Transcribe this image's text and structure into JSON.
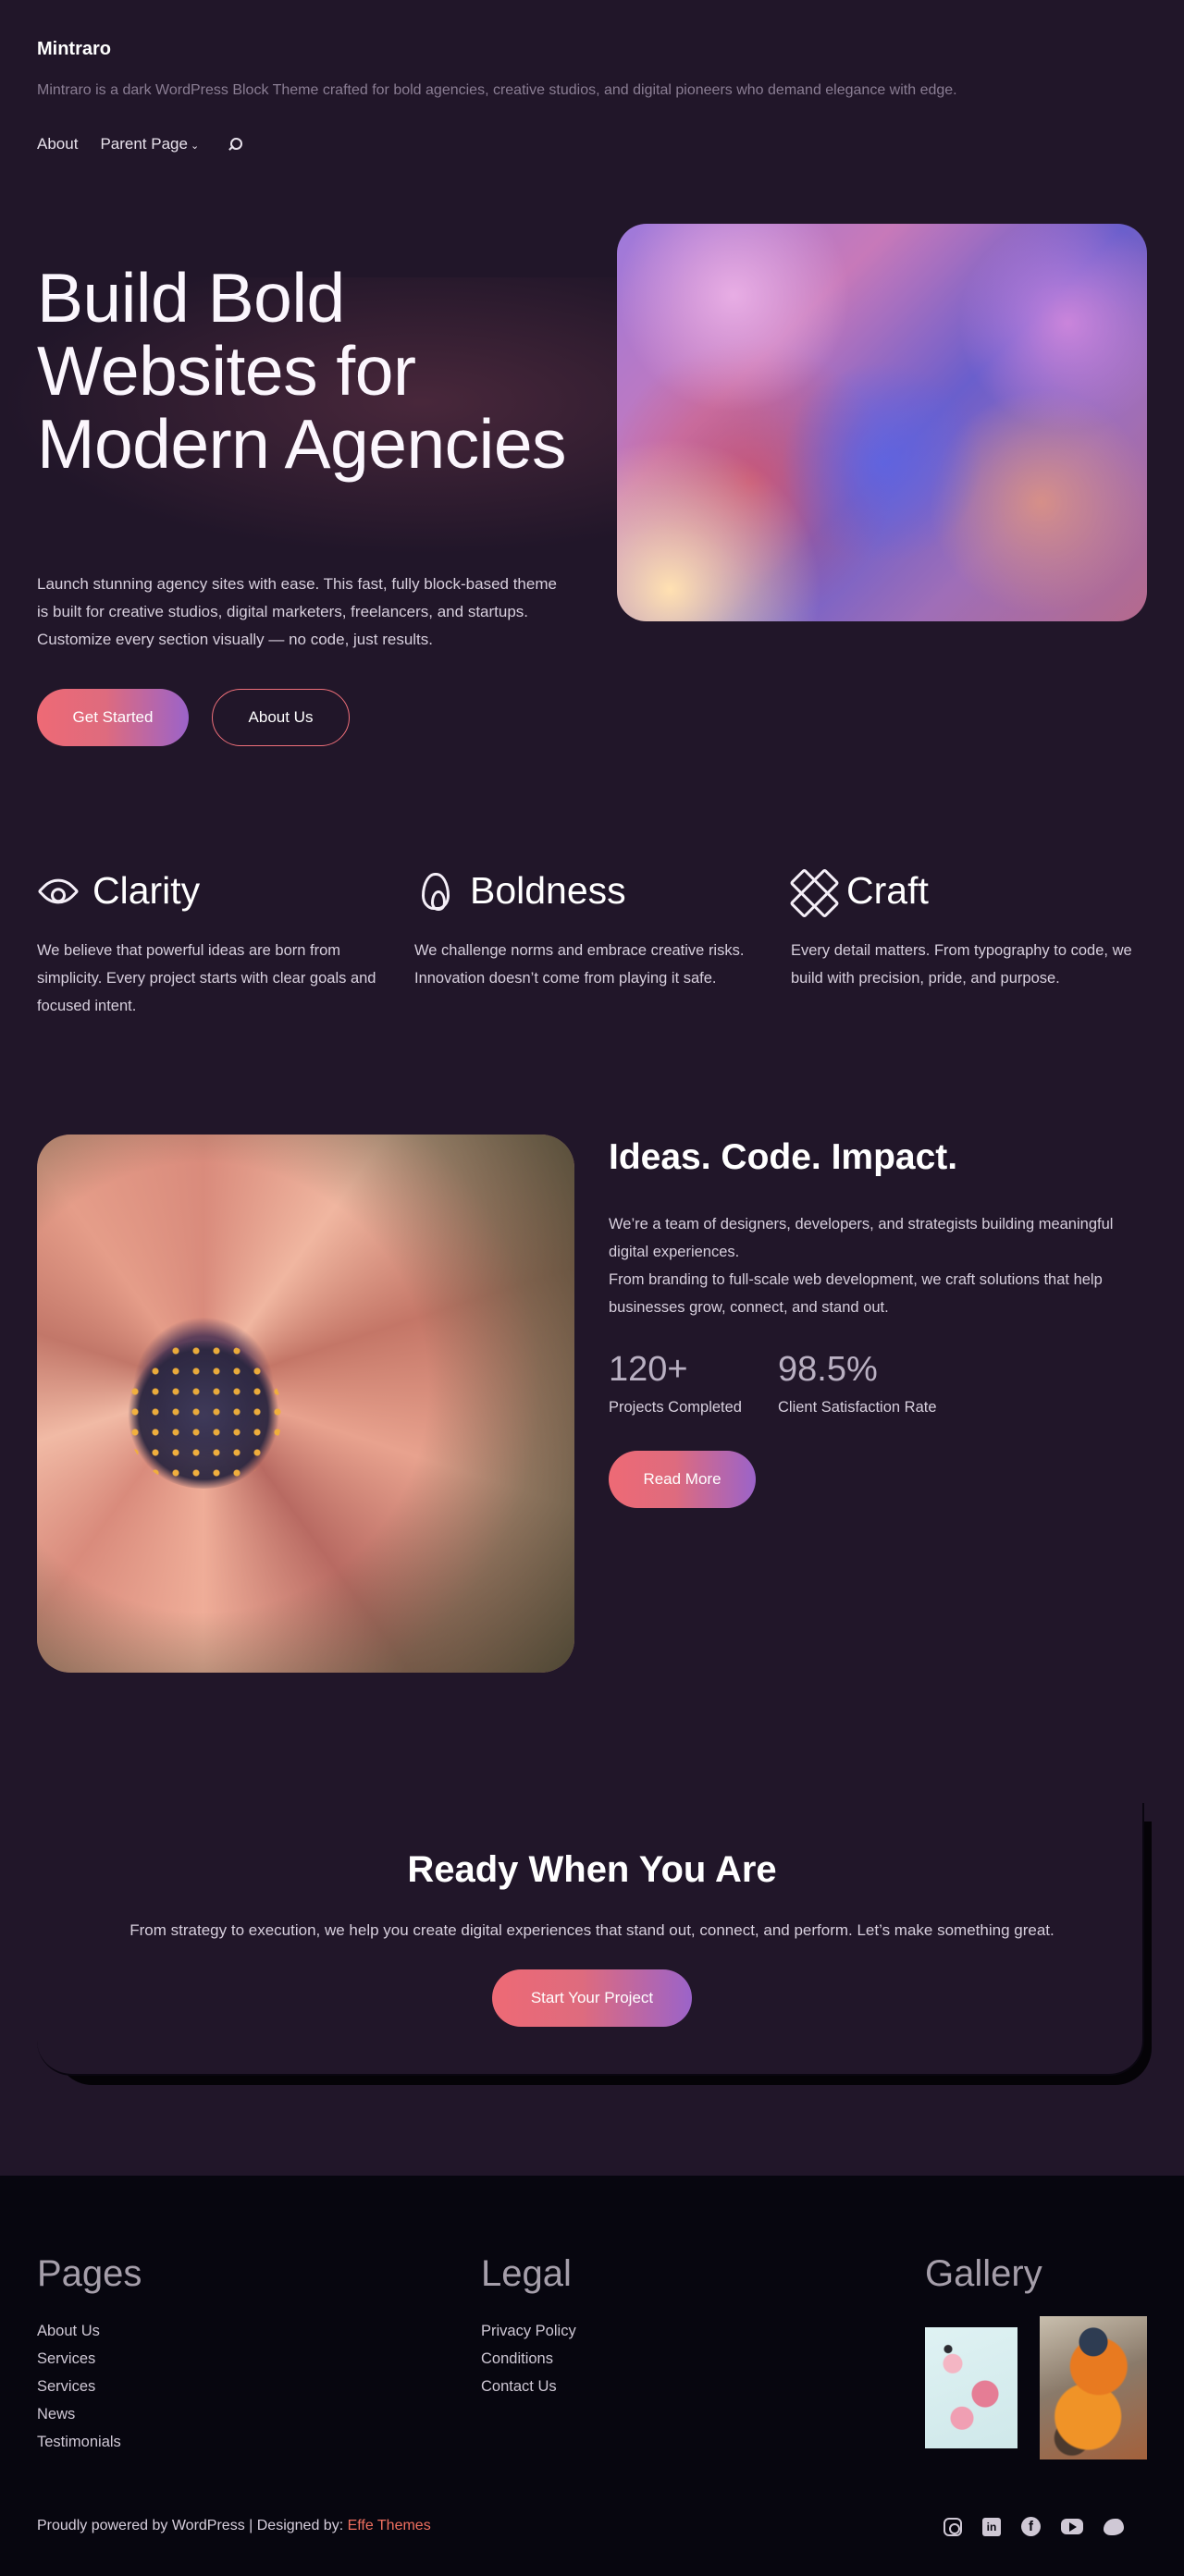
{
  "header": {
    "site_title": "Mintraro",
    "tagline": "Mintraro is a dark WordPress Block Theme crafted for bold agencies, creative studios, and digital pioneers who demand elegance with edge.",
    "nav": [
      {
        "label": "About"
      },
      {
        "label": "Parent Page",
        "has_submenu": true
      }
    ],
    "search_icon": "search-icon"
  },
  "hero": {
    "title": "Build Bold Websites for Modern Agencies",
    "text": "Launch stunning agency sites with ease. This fast, fully block-based theme is built for creative studios, digital marketers, freelancers, and startups. Customize every section visually — no code, just results.",
    "primary_button": "Get Started",
    "secondary_button": "About Us"
  },
  "values": [
    {
      "icon": "eye-icon",
      "title": "Clarity",
      "text": "We believe that powerful ideas are born from simplicity. Every project starts with clear goals and focused intent."
    },
    {
      "icon": "flame-icon",
      "title": "Boldness",
      "text": "We challenge norms and embrace creative risks. Innovation doesn’t come from playing it safe."
    },
    {
      "icon": "pencil-ruler-icon",
      "title": "Craft",
      "text": "Every detail matters. From typography to code, we build with precision, pride, and purpose."
    }
  ],
  "about": {
    "title": "Ideas. Code. Impact.",
    "text1": "We’re a team of designers, developers, and strategists building meaningful digital experiences.",
    "text2": "From branding to full-scale web development, we craft solutions that help businesses grow, connect, and stand out.",
    "stats": [
      {
        "value": "120+",
        "label": "Projects Completed"
      },
      {
        "value": "98.5%",
        "label": "Client Satisfaction Rate"
      }
    ],
    "button": "Read More"
  },
  "cta": {
    "title": "Ready When You Are",
    "text": "From strategy to execution, we help you create digital experiences that stand out, connect, and perform. Let’s make something great.",
    "button": "Start Your Project"
  },
  "footer": {
    "pages": {
      "title": "Pages",
      "links": [
        "About Us",
        "Services",
        "Services",
        "News",
        "Testimonials"
      ]
    },
    "legal": {
      "title": "Legal",
      "links": [
        "Privacy Policy",
        "Conditions",
        "Contact Us"
      ]
    },
    "gallery": {
      "title": "Gallery"
    },
    "credit_prefix": "Proudly powered by WordPress | Designed by: ",
    "credit_link": "Effe Themes",
    "social": [
      "instagram-icon",
      "linkedin-icon",
      "facebook-icon",
      "youtube-icon",
      "twitter-icon"
    ]
  },
  "colors": {
    "background": "#211629",
    "footer_background": "#07060f",
    "accent_start": "#ee6a75",
    "accent_end": "#9b63c9",
    "credit_link": "#ef6f5f"
  }
}
